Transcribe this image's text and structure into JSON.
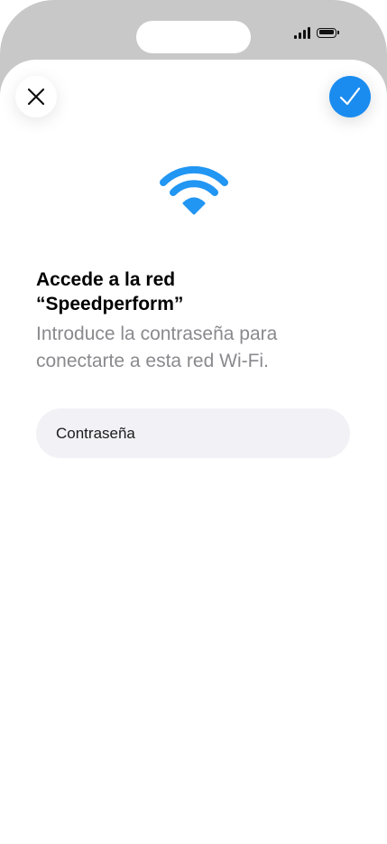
{
  "status_bar": {
    "signal_icon": "cellular-signal-icon",
    "battery_icon": "battery-icon"
  },
  "header": {
    "close_icon": "close-icon",
    "confirm_icon": "checkmark-icon"
  },
  "content": {
    "wifi_icon": "wifi-icon",
    "title_line1": "Accede a la red",
    "title_line2": "“Speedperform”",
    "subtitle_line1": "Introduce la contraseña para",
    "subtitle_line2": "conectarte a esta red Wi-Fi.",
    "password_placeholder": "Contraseña"
  },
  "colors": {
    "accent": "#1a8cf0",
    "wifi": "#2196f3",
    "secondary_text": "#8a8a8e",
    "field_background": "#f2f2f6",
    "bezel": "#c8c8c8"
  }
}
